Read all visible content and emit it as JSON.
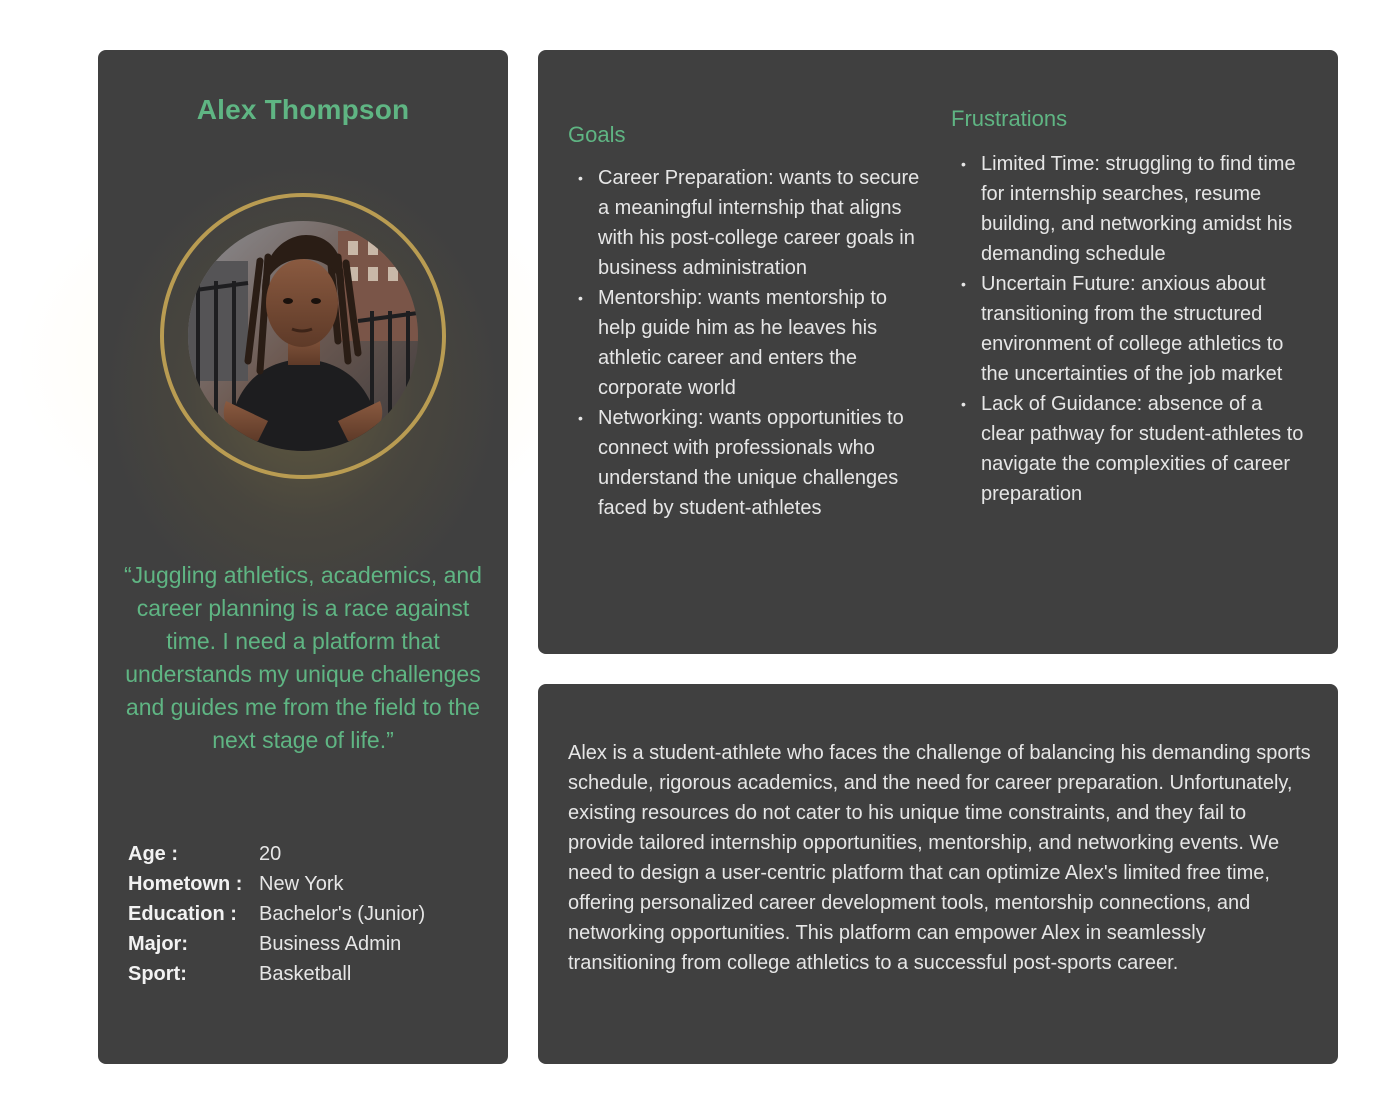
{
  "colors": {
    "accent_green": "#5fb583",
    "card_bg": "#404040",
    "ring_gold": "#b99c52",
    "text_light": "#e6e6e6"
  },
  "profile": {
    "name": "Alex Thompson",
    "quote": "“Juggling athletics, academics, and career planning is a race against time. I need a platform that understands my unique challenges and guides me from the field to the next stage of life.”",
    "facts": [
      {
        "label": "Age :",
        "value": "20"
      },
      {
        "label": "Hometown :",
        "value": "New York"
      },
      {
        "label": "Education :",
        "value": "Bachelor's (Junior)"
      },
      {
        "label": "Major:",
        "value": "Business Admin"
      },
      {
        "label": "Sport:",
        "value": "Basketball"
      }
    ]
  },
  "goals": {
    "title": "Goals",
    "items": [
      "Career Preparation: wants to secure a meaningful internship that aligns with his post-college career goals in business administration",
      "Mentorship: wants mentorship to help guide him as he leaves his athletic career and enters the corporate world",
      "Networking: wants opportunities to connect with professionals who understand the unique challenges faced by student-athletes"
    ]
  },
  "frustrations": {
    "title": "Frustrations",
    "items": [
      "Limited Time: struggling to find time for internship searches, resume building, and networking amidst his demanding schedule",
      "Uncertain Future: anxious about transitioning from the structured environment of college athletics to the uncertainties of the job market",
      "Lack of Guidance: absence of a clear pathway for student-athletes to navigate the complexities of career preparation"
    ]
  },
  "summary": {
    "text": "Alex is a student-athlete who faces the challenge of balancing his demanding sports schedule, rigorous academics, and the need for career preparation. Unfortunately, existing resources do not cater to his unique time constraints, and they fail to provide tailored internship opportunities, mentorship, and networking events. We need to design a user-centric platform that can optimize Alex's limited free time, offering personalized career development tools, mentorship connections, and networking opportunities. This platform can empower Alex in seamlessly transitioning from college athletics to a successful post-sports career."
  }
}
